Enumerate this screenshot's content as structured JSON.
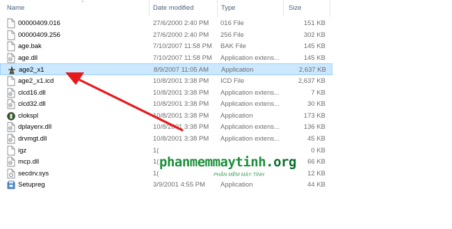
{
  "header": {
    "name": "Name",
    "date": "Date modified",
    "type": "Type",
    "size": "Size"
  },
  "files": [
    {
      "name": "00000409.016",
      "date": "27/6/2000 2:40 PM",
      "type": "016 File",
      "size": "151 KB",
      "icon": "file-icon"
    },
    {
      "name": "00000409.256",
      "date": "27/6/2000 2:40 PM",
      "type": "256 File",
      "size": "302 KB",
      "icon": "file-icon"
    },
    {
      "name": "age.bak",
      "date": "7/10/2007 11:58 PM",
      "type": "BAK File",
      "size": "145 KB",
      "icon": "file-icon"
    },
    {
      "name": "age.dll",
      "date": "7/10/2007 11:58 PM",
      "type": "Application extens...",
      "size": "145 KB",
      "icon": "dll-icon"
    },
    {
      "name": "age2_x1",
      "date": "8/9/2007 11:05 AM",
      "type": "Application",
      "size": "2,637 KB",
      "icon": "age-game-icon",
      "selected": true
    },
    {
      "name": "age2_x1.icd",
      "date": "10/8/2001 3:38 PM",
      "type": "ICD File",
      "size": "2,637 KB",
      "icon": "file-icon"
    },
    {
      "name": "clcd16.dll",
      "date": "10/8/2001 3:38 PM",
      "type": "Application extens...",
      "size": "7 KB",
      "icon": "dll-icon"
    },
    {
      "name": "clcd32.dll",
      "date": "10/8/2001 3:38 PM",
      "type": "Application extens...",
      "size": "30 KB",
      "icon": "dll-icon"
    },
    {
      "name": "clokspl",
      "date": "10/8/2001 3:38 PM",
      "type": "Application",
      "size": "173 KB",
      "icon": "clokspl-icon"
    },
    {
      "name": "dplayerx.dll",
      "date": "10/8/2001 3:38 PM",
      "type": "Application extens...",
      "size": "136 KB",
      "icon": "dll-icon"
    },
    {
      "name": "drvmgt.dll",
      "date": "10/8/2001 3:38 PM",
      "type": "Application extens...",
      "size": "45 KB",
      "icon": "dll-icon"
    },
    {
      "name": "igz",
      "date": "1(",
      "type": "",
      "size": "0 KB",
      "icon": "file-icon"
    },
    {
      "name": "mcp.dll",
      "date": "1(",
      "type": "",
      "size": "66 KB",
      "icon": "dll-icon"
    },
    {
      "name": "secdrv.sys",
      "date": "1(",
      "type": "",
      "size": "12 KB",
      "icon": "sys-icon"
    },
    {
      "name": "Setupreg",
      "date": "3/9/2001 4:55 PM",
      "type": "Application",
      "size": "44 KB",
      "icon": "setup-icon"
    }
  ],
  "watermark": {
    "main": "phanmemmaytinh",
    "tld": ".org",
    "sub": "PHẦN MỀM MÁY TÍNH"
  },
  "colors": {
    "selection": "#cce8ff",
    "selection_border": "#99d1ff",
    "arrow": "#e8191b",
    "watermark": "#1b8f3a"
  }
}
